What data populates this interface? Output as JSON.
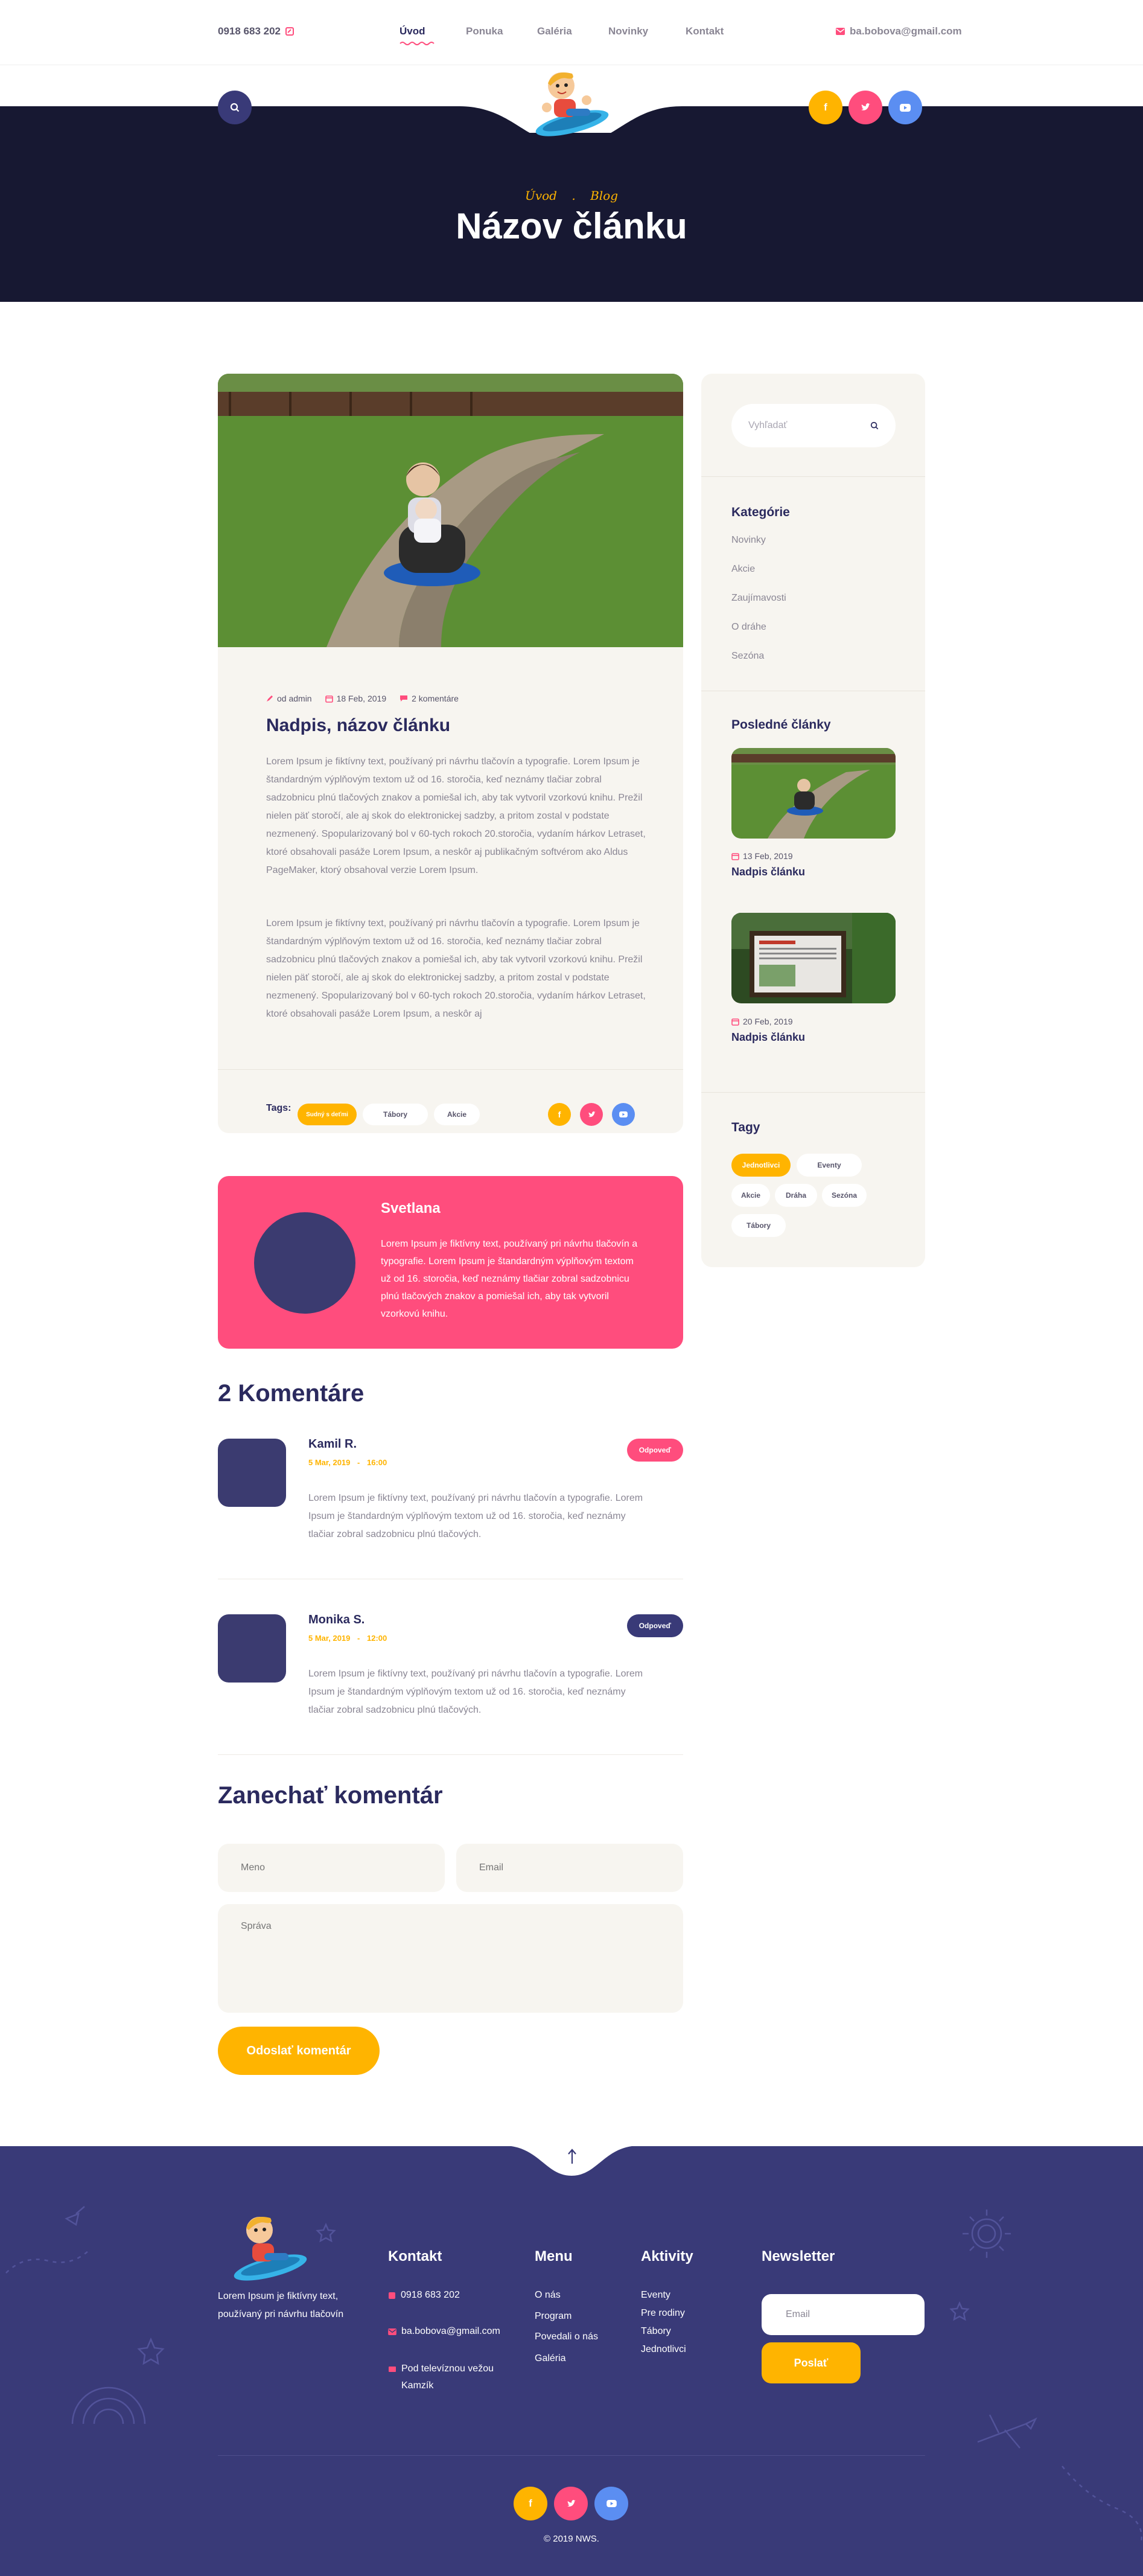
{
  "header": {
    "phone": "0918 683 202",
    "nav": [
      {
        "label": "Úvod",
        "active": true
      },
      {
        "label": "Ponuka",
        "active": false
      },
      {
        "label": "Galéria",
        "active": false
      },
      {
        "label": "Novinky",
        "active": false
      },
      {
        "label": "Kontakt",
        "active": false
      }
    ],
    "email": "ba.bobova@gmail.com",
    "social": [
      "f",
      "t",
      "yt"
    ]
  },
  "hero": {
    "crumb_home": "Úvod",
    "crumb_sep": ".",
    "crumb_current": "Blog",
    "title": "Názov článku"
  },
  "post": {
    "author": "od admin",
    "date": "18 Feb, 2019",
    "comments": "2 komentáre",
    "title": "Nadpis, názov článku",
    "para1": "Lorem Ipsum je fiktívny text, používaný pri návrhu tlačovín a typografie. Lorem Ipsum je štandardným výplňovým textom už od 16. storočia, keď neznámy tlačiar zobral sadzobnicu plnú tlačových znakov a pomiešal ich, aby tak vytvoril vzorkovú knihu. Prežil nielen päť storočí, ale aj skok do elektronickej sadzby, a pritom zostal v podstate nezmenený. Spopularizovaný bol v 60-tych rokoch 20.storočia, vydaním hárkov Letraset, ktoré obsahovali pasáže Lorem Ipsum, a neskôr aj publikačným softvérom ako Aldus PageMaker, ktorý obsahoval verzie Lorem Ipsum.",
    "para2": "Lorem Ipsum je fiktívny text, používaný pri návrhu tlačovín a typografie. Lorem Ipsum je štandardným výplňovým textom už od 16. storočia, keď neznámy tlačiar zobral sadzobnicu plnú tlačových znakov a pomiešal ich, aby tak vytvoril vzorkovú knihu. Prežil nielen päť storočí, ale aj skok do elektronickej sadzby, a pritom zostal v podstate nezmenený. Spopularizovaný bol v 60-tych rokoch 20.storočia, vydaním hárkov Letraset, ktoré obsahovali pasáže Lorem Ipsum, a neskôr aj",
    "tags_label": "Tags:",
    "tags": [
      "Sudný s deťmi",
      "Tábory",
      "Akcie"
    ]
  },
  "author_box": {
    "name": "Svetlana",
    "bio": "Lorem Ipsum je fiktívny text, používaný pri návrhu tlačovín a typografie. Lorem Ipsum je štandardným výplňovým textom už od 16. storočia, keď neznámy tlačiar zobral sadzobnicu plnú tlačových znakov a pomiešal ich, aby tak vytvoril vzorkovú knihu."
  },
  "comments": {
    "heading": "2 Komentáre",
    "items": [
      {
        "name": "Kamil R.",
        "date": "5 Mar, 2019",
        "sep": "-",
        "time": "16:00",
        "reply": "Odpoveď",
        "text": "Lorem Ipsum je fiktívny text, používaný pri návrhu tlačovín a typografie. Lorem Ipsum je štandardným výplňovým textom už od 16. storočia, keď neznámy tlačiar zobral sadzobnicu plnú tlačových."
      },
      {
        "name": "Monika S.",
        "date": "5 Mar, 2019",
        "sep": "-",
        "time": "12:00",
        "reply": "Odpoveď",
        "text": "Lorem Ipsum je fiktívny text, používaný pri návrhu tlačovín a typografie. Lorem Ipsum je štandardným výplňovým textom už od 16. storočia, keď neznámy tlačiar zobral sadzobnicu plnú tlačových."
      }
    ]
  },
  "form": {
    "heading": "Zanechať komentár",
    "name_placeholder": "Meno",
    "email_placeholder": "Email",
    "message_placeholder": "Správa",
    "submit": "Odoslať komentár"
  },
  "sidebar": {
    "search_placeholder": "Vyhľadať",
    "categories_title": "Kategórie",
    "categories": [
      "Novinky",
      "Akcie",
      "Zaujímavosti",
      "O dráhe",
      "Sezóna"
    ],
    "recent_title": "Posledné články",
    "recent": [
      {
        "date": "13 Feb, 2019",
        "title": "Nadpis článku"
      },
      {
        "date": "20 Feb, 2019",
        "title": "Nadpis článku"
      }
    ],
    "tags_title": "Tagy",
    "tags": [
      "Jednotlivci",
      "Eventy",
      "Akcie",
      "Dráha",
      "Sezóna",
      "Tábory"
    ]
  },
  "footer": {
    "about": "Lorem Ipsum je fiktívny text, používaný pri návrhu tlačovín",
    "contact_title": "Kontakt",
    "contact_phone": "0918 683 202",
    "contact_email": "ba.bobova@gmail.com",
    "contact_address": "Pod televíznou vežou Kamzík",
    "menu_title": "Menu",
    "menu": [
      "O nás",
      "Program",
      "Povedali o nás",
      "Galéria"
    ],
    "activities_title": "Aktivity",
    "activities": [
      "Eventy",
      "Pre rodiny",
      "Tábory",
      "Jednotlivci"
    ],
    "newsletter_title": "Newsletter",
    "newsletter_placeholder": "Email",
    "newsletter_button": "Poslať",
    "copyright": "© 2019 NWS."
  },
  "colors": {
    "navy": "#171832",
    "indigo": "#393a78",
    "pink": "#ff4d7d",
    "yellow": "#ffb400",
    "blue": "#5b8ef2",
    "cream": "#f7f5f0"
  }
}
